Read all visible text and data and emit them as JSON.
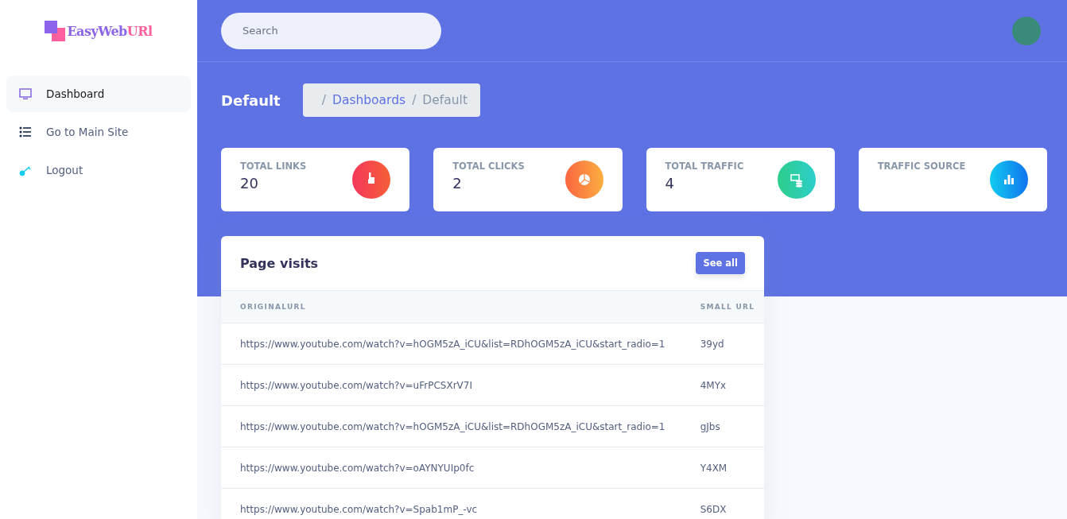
{
  "logo": [
    {
      "text": "EasyWeb",
      "color": "#8b64e9"
    },
    {
      "text": "URl",
      "color": "#fe5f9f"
    }
  ],
  "sidebar": {
    "items": [
      {
        "label": "Dashboard",
        "kind": "monitor",
        "selected": true
      },
      {
        "label": "Go to Main Site",
        "kind": "list",
        "selected": false
      },
      {
        "label": "Logout",
        "kind": "key",
        "selected": false
      }
    ]
  },
  "search": {
    "placeholder": "Search"
  },
  "header": {
    "title": "Default",
    "breadcrumb": [
      {
        "separator": "/",
        "label": "Dashboards",
        "kind": "link"
      },
      {
        "separator": "/",
        "label": "Default",
        "kind": "current"
      }
    ]
  },
  "stats": [
    {
      "title": "TOTAL LINKS",
      "value": "20",
      "kind": "hand",
      "color": "#f5365c"
    },
    {
      "title": "TOTAL CLICKS",
      "value": "2",
      "kind": "pie",
      "color": "#fb6340"
    },
    {
      "title": "TOTAL TRAFFIC",
      "value": "4",
      "kind": "money",
      "color": "#2dce89"
    },
    {
      "title": "TRAFFIC SOURCE",
      "kind": "bars",
      "color": "#11cdef"
    }
  ],
  "table": {
    "title": "Page visits",
    "button": "See all",
    "columns": [
      "ORIGINALURL",
      "SMALL URL"
    ],
    "rows": [
      [
        "https://www.youtube.com/watch?v=hOGM5zA_iCU&list=RDhOGM5zA_iCU&start_radio=1",
        "39yd"
      ],
      [
        "https://www.youtube.com/watch?v=uFrPCSXrV7I",
        "4MYx"
      ],
      [
        "https://www.youtube.com/watch?v=hOGM5zA_iCU&list=RDhOGM5zA_iCU&start_radio=1",
        "gJbs"
      ],
      [
        "https://www.youtube.com/watch?v=oAYNYUIp0fc",
        "Y4XM"
      ],
      [
        "https://www.youtube.com/watch?v=Spab1mP_-vc",
        "S6DX"
      ]
    ]
  }
}
